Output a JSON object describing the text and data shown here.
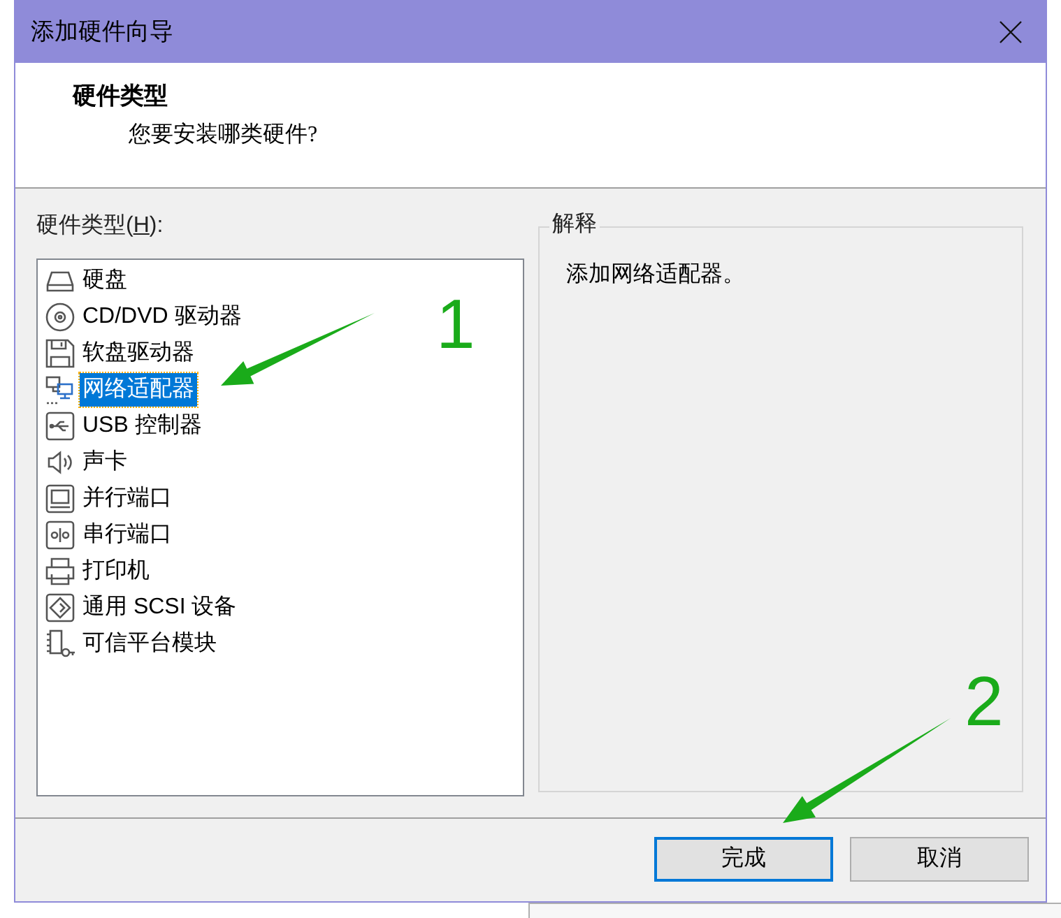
{
  "window": {
    "title": "添加硬件向导"
  },
  "header": {
    "title": "硬件类型",
    "subtitle": "您要安装哪类硬件?"
  },
  "hardware_list": {
    "label": {
      "before": "硬件类型(",
      "access_key": "H",
      "after": "):"
    },
    "items": [
      {
        "label": "硬盘",
        "kind": "disk",
        "selected": false
      },
      {
        "label": "CD/DVD 驱动器",
        "kind": "optical",
        "selected": false
      },
      {
        "label": "软盘驱动器",
        "kind": "floppy",
        "selected": false
      },
      {
        "label": "网络适配器",
        "kind": "network",
        "selected": true
      },
      {
        "label": "USB 控制器",
        "kind": "usb",
        "selected": false
      },
      {
        "label": "声卡",
        "kind": "sound",
        "selected": false
      },
      {
        "label": "并行端口",
        "kind": "parallel",
        "selected": false
      },
      {
        "label": "串行端口",
        "kind": "serial",
        "selected": false
      },
      {
        "label": "打印机",
        "kind": "printer",
        "selected": false
      },
      {
        "label": "通用 SCSI 设备",
        "kind": "scsi",
        "selected": false
      },
      {
        "label": "可信平台模块",
        "kind": "tpm",
        "selected": false
      }
    ]
  },
  "description": {
    "legend": "解释",
    "text": "添加网络适配器。"
  },
  "buttons": [
    {
      "label": "完成",
      "default": true
    },
    {
      "label": "取消",
      "default": false
    }
  ],
  "annotations": [
    {
      "label": "1"
    },
    {
      "label": "2"
    }
  ]
}
